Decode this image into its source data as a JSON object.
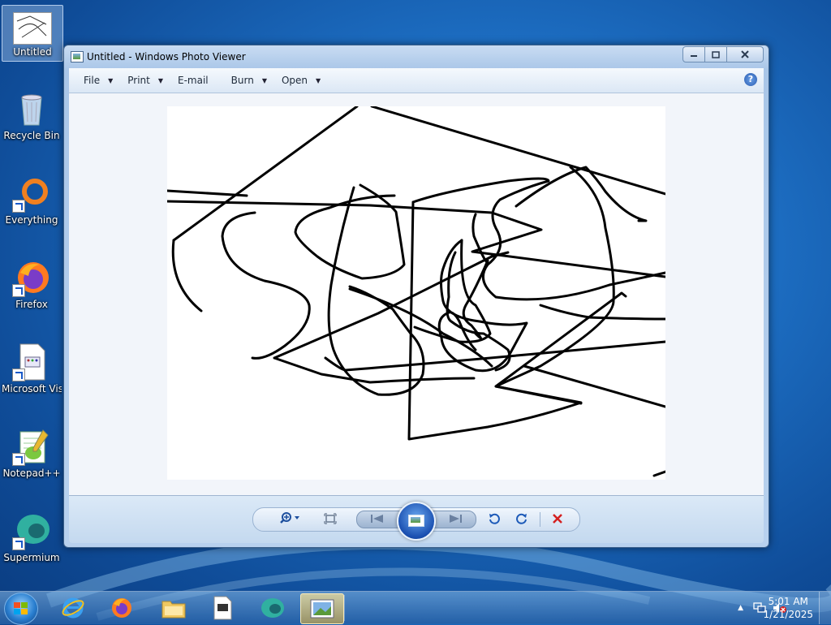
{
  "desktop": {
    "icons": [
      {
        "label": "Untitled",
        "icon": "image-file-icon",
        "selected": true
      },
      {
        "label": "Recycle Bin",
        "icon": "recycle-bin-icon"
      },
      {
        "label": "Everything",
        "icon": "everything-search-icon"
      },
      {
        "label": "Firefox",
        "icon": "firefox-icon"
      },
      {
        "label": "Microsoft Visual Stud...",
        "icon": "visual-studio-file-icon"
      },
      {
        "label": "Notepad++",
        "icon": "notepadpp-icon"
      },
      {
        "label": "Supermium",
        "icon": "supermium-icon"
      }
    ]
  },
  "window": {
    "title": "Untitled - Windows Photo Viewer",
    "controls": {
      "minimize": "minimize-icon",
      "maximize": "maximize-icon",
      "close": "close-icon"
    },
    "menu": [
      {
        "label": "File",
        "has_arrow": true
      },
      {
        "label": "Print",
        "has_arrow": true
      },
      {
        "label": "E-mail",
        "has_arrow": false
      },
      {
        "label": "Burn",
        "has_arrow": true
      },
      {
        "label": "Open",
        "has_arrow": true
      }
    ],
    "help_glyph": "?",
    "toolbar": {
      "zoom": "zoom-icon",
      "fit": "actual-size-icon",
      "previous": "previous-icon",
      "slideshow": "slideshow-icon",
      "next": "next-icon",
      "rotate_ccw": "rotate-counterclockwise-icon",
      "rotate_cw": "rotate-clockwise-icon",
      "delete": "delete-icon"
    }
  },
  "taskbar": {
    "apps": [
      "start-button",
      "internet-explorer-icon",
      "firefox-icon",
      "file-explorer-icon",
      "visual-studio-file-icon",
      "supermium-icon",
      "photo-viewer-icon"
    ],
    "active_app": "photo-viewer-icon",
    "tray": [
      "show-hidden-icons-arrow",
      "network-icon",
      "volume-muted-icon"
    ],
    "clock": {
      "time": "5:01 AM",
      "date": "1/21/2025"
    }
  },
  "colors": {
    "desktop_bg": "#1c6cc0",
    "window_frame": "#b8d1ee",
    "delete_red": "#d42020"
  }
}
